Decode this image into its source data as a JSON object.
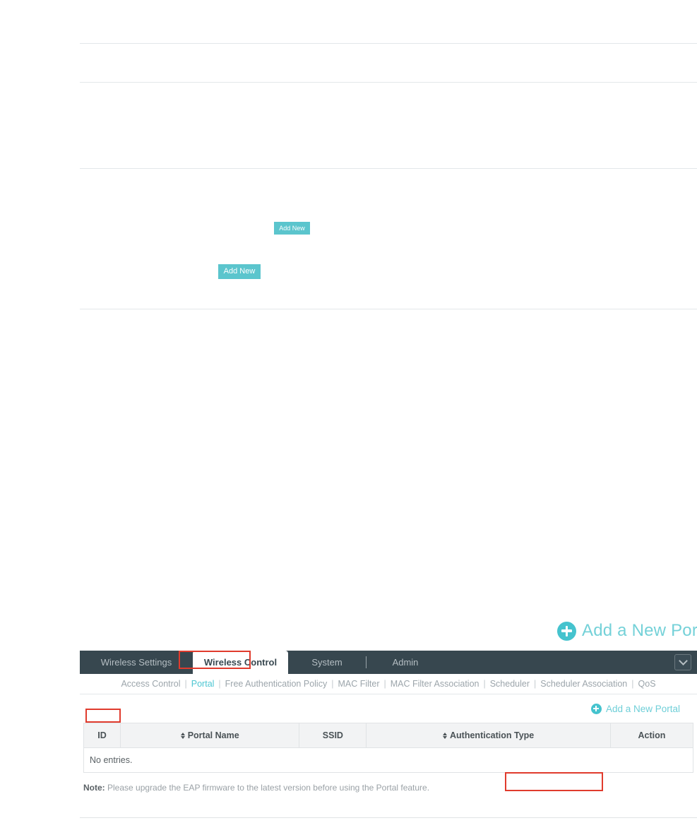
{
  "document_area": {
    "rules": [
      1,
      2,
      3,
      4
    ],
    "buttons": [
      {
        "id": "addnew-small",
        "label": "Add New"
      },
      {
        "id": "addnew-large",
        "label": "Add New"
      }
    ]
  },
  "callout": {
    "icon": "plus-circle-icon",
    "label": "Add a New Portal",
    "color": "#74d1d8"
  },
  "panel": {
    "main_nav": {
      "tabs": [
        {
          "label": "Wireless Settings",
          "active": false
        },
        {
          "label": "Wireless Control",
          "active": true
        },
        {
          "label": "System",
          "active": false
        },
        {
          "label": "Admin",
          "active": false
        }
      ],
      "dropdown_icon": "chevron-down-icon",
      "background": "#37474f"
    },
    "sub_nav": {
      "items": [
        {
          "label": "Access Control",
          "active": false
        },
        {
          "label": "Portal",
          "active": true
        },
        {
          "label": "Free Authentication Policy",
          "active": false
        },
        {
          "label": "MAC Filter",
          "active": false
        },
        {
          "label": "MAC Filter Association",
          "active": false
        },
        {
          "label": "Scheduler",
          "active": false
        },
        {
          "label": "Scheduler Association",
          "active": false
        },
        {
          "label": "QoS",
          "active": false
        }
      ],
      "divider": "|",
      "active_color": "#4cc6d2"
    },
    "add_portal_link": {
      "icon": "plus-circle-icon",
      "label": "Add a New Portal",
      "color": "#6fcfd8"
    },
    "table": {
      "columns": [
        {
          "label": "ID",
          "sortable": false
        },
        {
          "label": "Portal Name",
          "sortable": true
        },
        {
          "label": "SSID",
          "sortable": false
        },
        {
          "label": "Authentication Type",
          "sortable": true
        },
        {
          "label": "Action",
          "sortable": false
        }
      ],
      "empty_message": "No entries.",
      "rows": []
    },
    "note": {
      "label": "Note:",
      "text": "Please upgrade the EAP firmware to the latest version before using the Portal feature."
    }
  },
  "highlights": {
    "wireless_control": "Wireless Control",
    "portal": "Portal",
    "add_a_new_portal": "Add a New Portal",
    "color": "#e03b2d"
  }
}
